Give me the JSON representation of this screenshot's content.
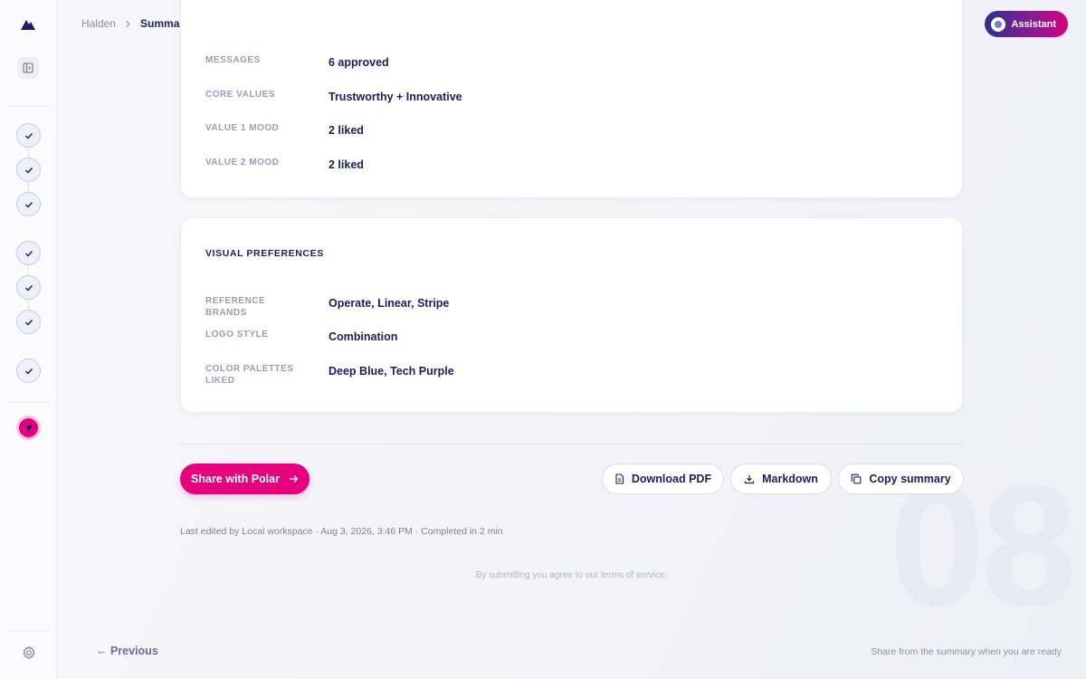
{
  "header": {
    "breadcrumb_parent": "Halden",
    "breadcrumb_current": "Summary",
    "assistant_label": "Assistant"
  },
  "sidebar": {
    "steps": [
      {
        "state": "complete",
        "icon": "check-icon"
      },
      {
        "state": "complete",
        "icon": "check-icon"
      },
      {
        "state": "complete",
        "icon": "check-icon"
      },
      {
        "state": "complete",
        "icon": "check-icon"
      },
      {
        "state": "complete",
        "icon": "check-icon"
      },
      {
        "state": "complete",
        "icon": "check-icon"
      },
      {
        "state": "complete",
        "icon": "check-icon"
      },
      {
        "state": "current",
        "icon": "arrow-down-icon"
      }
    ]
  },
  "summary_top": {
    "rows": [
      {
        "label": "MESSAGES",
        "value": "6 approved"
      },
      {
        "label": "CORE VALUES",
        "value": "Trustworthy + Innovative"
      },
      {
        "label": "VALUE 1 MOOD",
        "value": "2 liked"
      },
      {
        "label": "VALUE 2 MOOD",
        "value": "2 liked"
      }
    ]
  },
  "visual_preferences": {
    "title": "VISUAL PREFERENCES",
    "rows": [
      {
        "label": "REFERENCE BRANDS",
        "value": "Operate, Linear, Stripe"
      },
      {
        "label": "LOGO STYLE",
        "value": "Combination"
      },
      {
        "label": "COLOR PALETTES LIKED",
        "value": "Deep Blue, Tech Purple"
      }
    ]
  },
  "actions": {
    "share_label": "Share with Polar",
    "download_pdf_label": "Download PDF",
    "markdown_label": "Markdown",
    "copy_label": "Copy summary"
  },
  "meta_text": "Last edited by Local workspace · Aug 3, 2026, 3:46 PM · Completed in 2 min",
  "terms_text": "By submitting you agree to our terms of service.",
  "step_number": "08",
  "footer": {
    "previous_label": "← Previous",
    "hint": "Share from the summary when you are ready"
  },
  "colors": {
    "accent": "#e6007e",
    "navy": "#1c1d5e",
    "muted": "#9a9cb7"
  }
}
